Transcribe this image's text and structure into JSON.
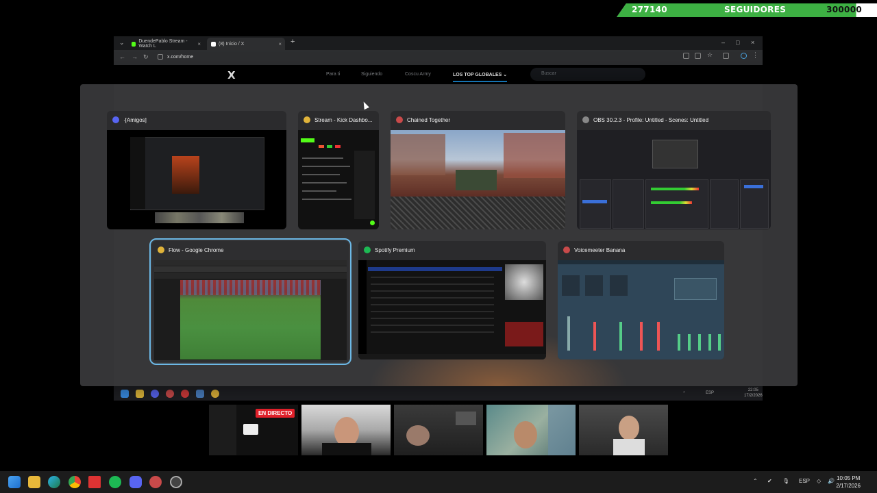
{
  "followers": {
    "current": "277140",
    "label": "SEGUIDORES",
    "goal": "300000",
    "progress": 0.92
  },
  "browser": {
    "tabs": [
      {
        "label": "DuendePablo Stream - Watch L",
        "icon": "kick-icon"
      },
      {
        "label": "(8) Inicio / X",
        "icon": "x-icon"
      }
    ],
    "new_tab": "+",
    "url": "x.com/home",
    "x_logo": "X",
    "x_tabs": [
      "Para ti",
      "Siguiendo",
      "Coscu Army",
      "LOS TOP GLOBALES ⌄"
    ],
    "search_placeholder": "Buscar",
    "inner_tray": {
      "lang": "ESP",
      "time": "22:05",
      "date": "17/2/2026"
    }
  },
  "alt_tab": {
    "windows": [
      {
        "title": "·[Amigos]",
        "app": "discord"
      },
      {
        "title": "Stream - Kick Dashbo...",
        "app": "chrome"
      },
      {
        "title": "Chained Together",
        "app": "game"
      },
      {
        "title": "OBS 30.2.3 - Profile: Untitled - Scenes: Untitled",
        "app": "obs"
      },
      {
        "title": "Flow - Google Chrome",
        "app": "chrome"
      },
      {
        "title": "Spotify Premium",
        "app": "spotify"
      },
      {
        "title": "Voicemeeter Banana",
        "app": "voicemeeter"
      }
    ],
    "selected": "Flow - Google Chrome"
  },
  "stream": {
    "live_label": "EN DIRECTO"
  },
  "taskbar": {
    "apps": [
      "windows-start",
      "file-explorer",
      "edge",
      "chrome",
      "kick-app",
      "spotify",
      "discord",
      "game-launcher",
      "obs"
    ],
    "lang": "ESP",
    "time": "10:05 PM",
    "date": "2/17/2026"
  },
  "colors": {
    "accent": "#6cb8e6",
    "follower_green": "#3db043",
    "live_red": "#e0202a"
  }
}
